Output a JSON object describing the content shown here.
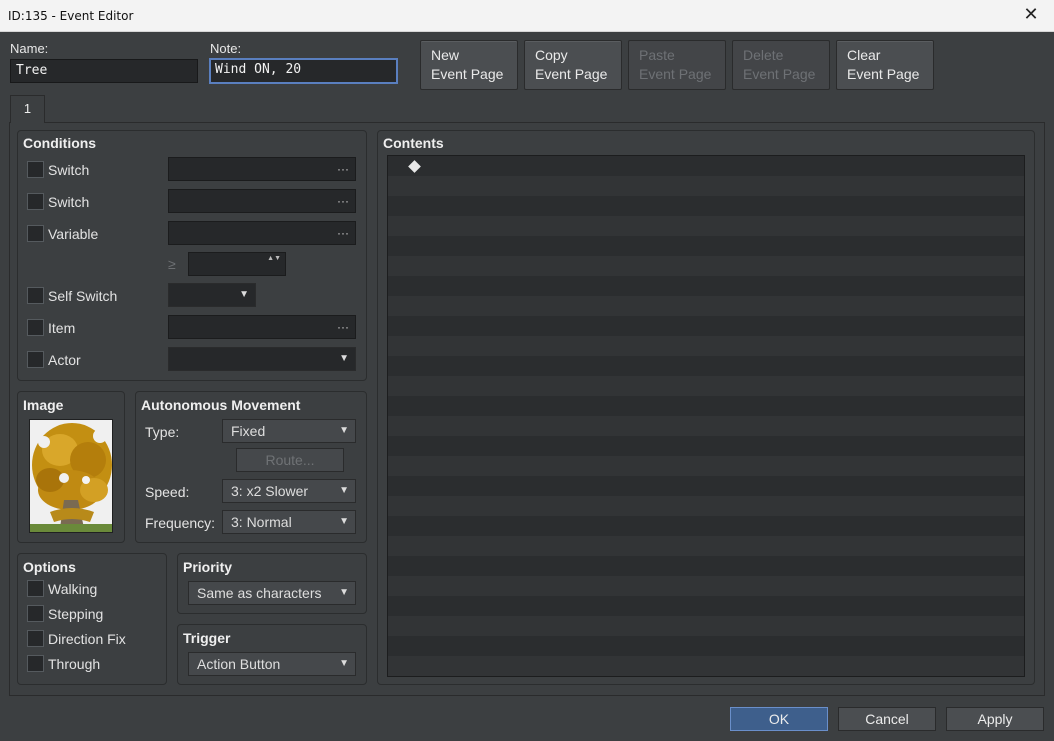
{
  "window": {
    "title": "ID:135 - Event Editor",
    "close": "✕"
  },
  "name": {
    "label": "Name:",
    "value": "Tree"
  },
  "note": {
    "label": "Note:",
    "value": "Wind ON, 20"
  },
  "toolbar": {
    "new_line1": "New",
    "new_line2": "Event Page",
    "copy_line1": "Copy",
    "copy_line2": "Event Page",
    "paste_line1": "Paste",
    "paste_line2": "Event Page",
    "delete_line1": "Delete",
    "delete_line2": "Event Page",
    "clear_line1": "Clear",
    "clear_line2": "Event Page"
  },
  "tabs": [
    {
      "label": "1"
    }
  ],
  "conditions": {
    "title": "Conditions",
    "switch1": "Switch",
    "switch2": "Switch",
    "variable": "Variable",
    "gte": "≥",
    "self_switch": "Self Switch",
    "item": "Item",
    "actor": "Actor",
    "dots": "···",
    "arrow": "▼",
    "spin_arrows": "▲▼"
  },
  "image": {
    "title": "Image",
    "icon": "tree-sprite"
  },
  "movement": {
    "title": "Autonomous Movement",
    "type_label": "Type:",
    "type_value": "Fixed",
    "route_label": "Route...",
    "speed_label": "Speed:",
    "speed_value": "3: x2 Slower",
    "frequency_label": "Frequency:",
    "frequency_value": "3: Normal"
  },
  "options": {
    "title": "Options",
    "walking": "Walking",
    "stepping": "Stepping",
    "direction_fix": "Direction Fix",
    "through": "Through"
  },
  "priority": {
    "title": "Priority",
    "value": "Same as characters"
  },
  "trigger": {
    "title": "Trigger",
    "value": "Action Button"
  },
  "contents": {
    "title": "Contents"
  },
  "footer": {
    "ok": "OK",
    "cancel": "Cancel",
    "apply": "Apply"
  },
  "colors": {
    "accent": "#3e5f8c",
    "background": "#3c3f41",
    "field": "#26282a"
  }
}
